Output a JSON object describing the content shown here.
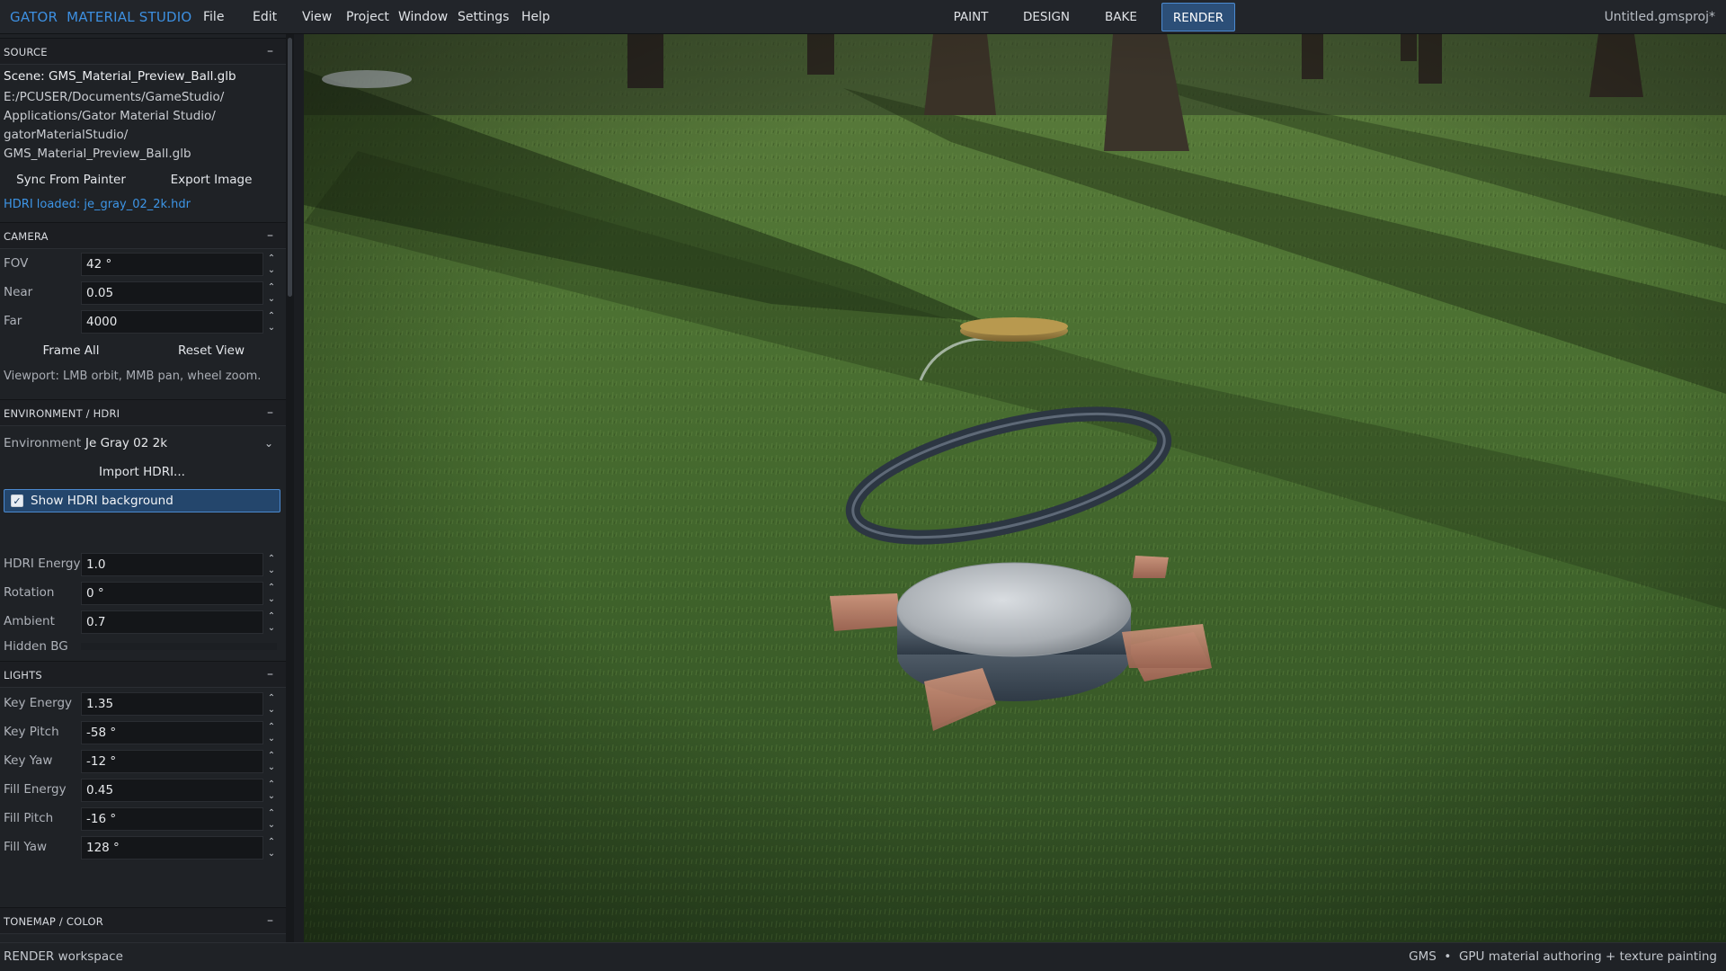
{
  "app": {
    "title_part1": "GATOR",
    "title_part2": "MATERIAL STUDIO",
    "document_title": "Untitled.gmsproj*",
    "accent_color": "#3d8fe0"
  },
  "menu": [
    "File",
    "Edit",
    "View",
    "Project",
    "Window",
    "Settings",
    "Help"
  ],
  "workspace_tabs": [
    {
      "label": "PAINT",
      "active": false
    },
    {
      "label": "DESIGN",
      "active": false
    },
    {
      "label": "BAKE",
      "active": false
    },
    {
      "label": "RENDER",
      "active": true
    }
  ],
  "source": {
    "header": "SOURCE",
    "collapse": "–",
    "scene_line": "Scene: GMS_Material_Preview_Ball.glb",
    "path_lines": [
      "E:/PCUSER/Documents/GameStudio/",
      "Applications/Gator Material Studio/",
      "gatorMaterialStudio/",
      "GMS_Material_Preview_Ball.glb"
    ],
    "sync_button": "Sync From Painter",
    "export_button": "Export Image",
    "hdri_status": "HDRI loaded: je_gray_02_2k.hdr"
  },
  "camera": {
    "header": "CAMERA",
    "collapse": "–",
    "fov_label": "FOV",
    "fov_value": "42 °",
    "near_label": "Near",
    "near_value": "0.05",
    "far_label": "Far",
    "far_value": "4000",
    "frame_all_button": "Frame All",
    "reset_view_button": "Reset View",
    "hint": "Viewport: LMB orbit, MMB pan, wheel zoom."
  },
  "environment": {
    "header": "ENVIRONMENT / HDRI",
    "collapse": "–",
    "env_label": "Environment",
    "env_value": "Je Gray 02 2k",
    "import_button": "Import HDRI...",
    "show_bg_label": "Show HDRI background",
    "show_bg_checked": true,
    "energy_label": "HDRI Energy",
    "energy_value": "1.0",
    "rotation_label": "Rotation",
    "rotation_value": "0 °",
    "ambient_label": "Ambient",
    "ambient_value": "0.7",
    "hidden_bg_label": "Hidden BG"
  },
  "lights": {
    "header": "LIGHTS",
    "collapse": "–",
    "key_energy_label": "Key Energy",
    "key_energy_value": "1.35",
    "key_pitch_label": "Key Pitch",
    "key_pitch_value": "-58 °",
    "key_yaw_label": "Key Yaw",
    "key_yaw_value": "-12 °",
    "fill_energy_label": "Fill Energy",
    "fill_energy_value": "0.45",
    "fill_pitch_label": "Fill Pitch",
    "fill_pitch_value": "-16 °",
    "fill_yaw_label": "Fill Yaw",
    "fill_yaw_value": "128 °"
  },
  "tonemap": {
    "header": "TONEMAP / COLOR",
    "collapse": "–"
  },
  "statusbar": {
    "left": "RENDER workspace",
    "right_app": "GMS",
    "separator": "•",
    "right_desc": "GPU material authoring + texture painting"
  },
  "icons": {
    "spin_up": "chevron-up-icon",
    "spin_down": "chevron-down-icon",
    "dropdown": "chevron-down-icon",
    "checkbox": "checkmark-icon"
  }
}
